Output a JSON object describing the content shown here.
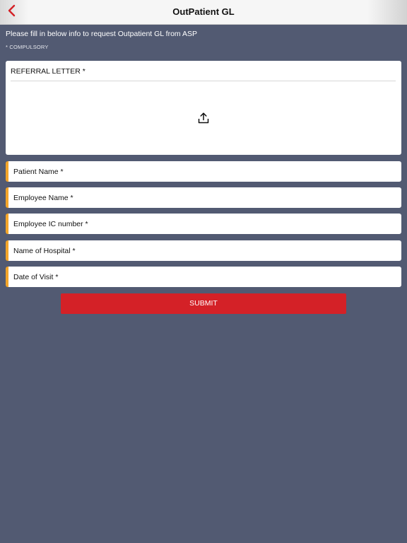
{
  "header": {
    "title": "OutPatient GL",
    "back_icon": "chevron-left-icon",
    "accent_color": "#d42127"
  },
  "intro": {
    "text": "Please fill in below info to request Outpatient GL from ASP",
    "compulsory_note": "* COMPULSORY"
  },
  "upload": {
    "label": "REFERRAL LETTER *",
    "icon": "upload-icon"
  },
  "fields": [
    {
      "placeholder": "Patient Name *"
    },
    {
      "placeholder": "Employee Name *"
    },
    {
      "placeholder": "Employee IC number *"
    },
    {
      "placeholder": "Name of Hospital *"
    },
    {
      "placeholder": "Date of Visit *"
    }
  ],
  "submit": {
    "label": "SUBMIT"
  },
  "colors": {
    "background": "#525a72",
    "field_marker": "#f3a52a",
    "submit": "#d42127"
  }
}
